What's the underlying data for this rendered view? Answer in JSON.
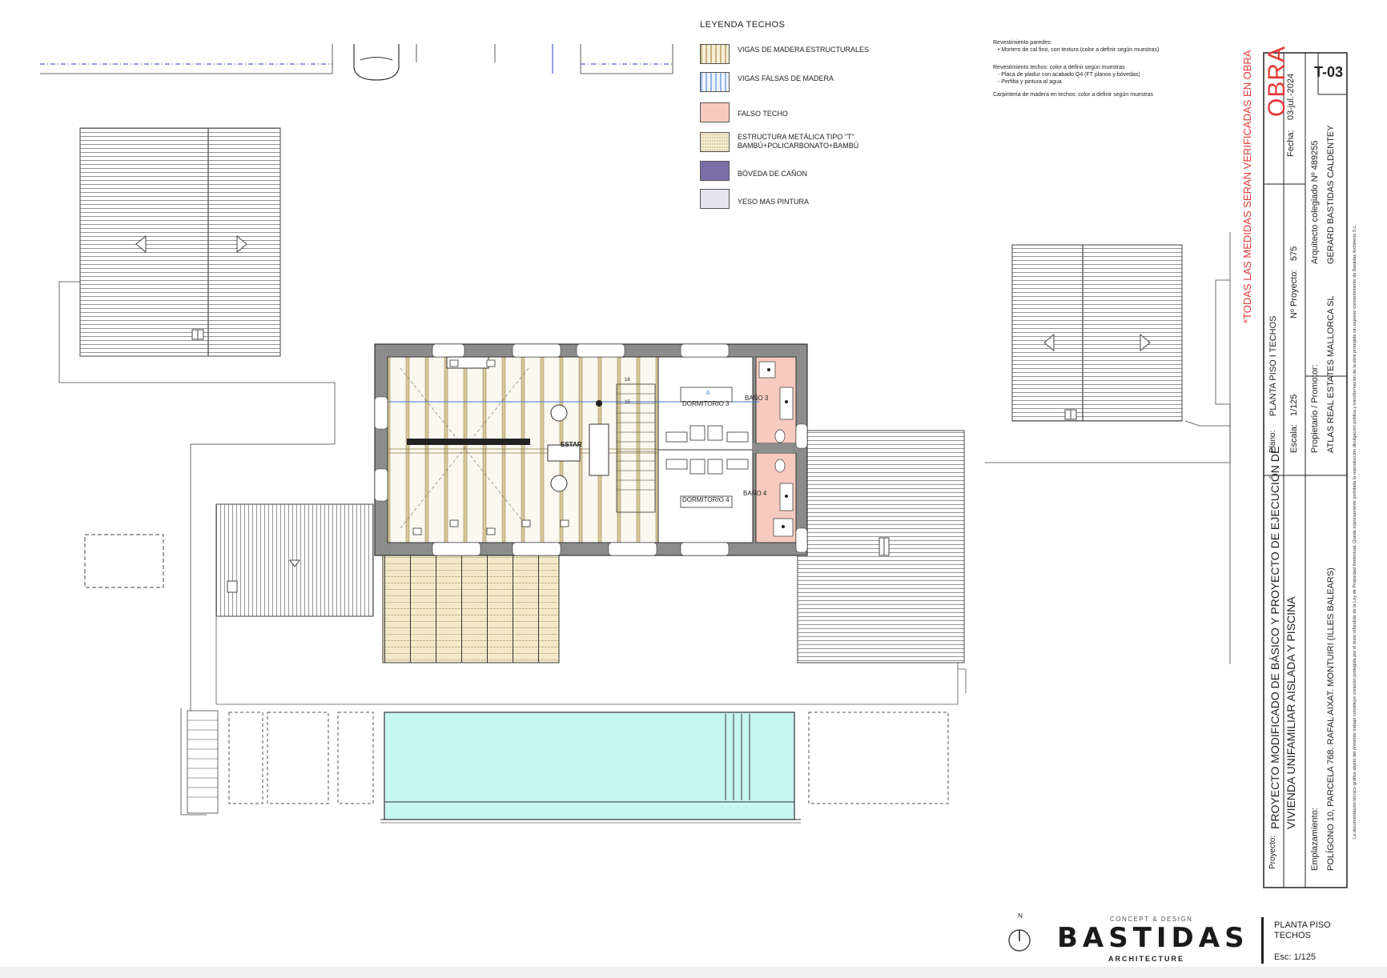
{
  "legend": {
    "title": "LEYENDA TECHOS",
    "items": [
      {
        "label": "VIGAS DE MADERA ESTRUCTURALES",
        "swatch": "wood-beams"
      },
      {
        "label": "VIGAS FALSAS DE MADERA",
        "swatch": "fake-beams"
      },
      {
        "label": "FALSO TECHO",
        "swatch": "false-ceiling"
      },
      {
        "label": "ESTRUCTURA METÁLICA TIPO \"T\"\nBAMBÚ+POLICARBONATO+BAMBÚ",
        "swatch": "metal-t"
      },
      {
        "label": "BÓVEDA DE CAÑON",
        "swatch": "barrel-vault"
      },
      {
        "label": "YESO MAS PINTURA",
        "swatch": "plaster"
      }
    ]
  },
  "notes": {
    "walls_title": "Revestimiento paredes:",
    "walls_item": "•      Mortero de cal fino, con textura (color a definir según muestras)",
    "ceilings_title": "Revestimiento techos: color a definir según muestras",
    "ceilings_item1": "- Placa de pladur con acabado Q4 (FT planos y bóvedas)",
    "ceilings_item2": "- Perfilta y pintura al agua",
    "carpentry": "Carpintería de madera en techos: color a definir según muestras"
  },
  "plan_labels": {
    "estar": "ESTAR",
    "dormitorio3": "DORMITORIO 3",
    "dormitorio4": "DORMITORIO 4",
    "bano3": "BAÑO 3",
    "bano4": "BAÑO 4",
    "stair_top": "18",
    "stair_mid": "15",
    "section_mark": "A"
  },
  "title_block": {
    "warning": "*TODAS LAS MEDIDAS SERAN VERIFICADAS EN OBRA",
    "sheet_code": "T-03",
    "obra": "OBRA",
    "fecha_label": "Fecha:",
    "fecha_value": "03-jul.-2024",
    "plano_label": "Plano:",
    "plano_value": "PLANTA PISO I TECHOS",
    "escala_label": "Escala:",
    "escala_value": "1/125",
    "nproyecto_label": "Nº Proyecto:",
    "nproyecto_value": "575",
    "propietario_label": "Propietario / Promotor:",
    "propietario_value": "ATLAS REAL ESTATES MALLORCA SL",
    "arquitecto_label": "Arquitecto colegiado Nº 489255",
    "arquitecto_value": "GERARD BASTIDAS CALDENTEY",
    "proyecto_label": "Proyecto:",
    "proyecto_line1": "PROYECTO  MODIFICADO DE BÁSICO Y PROYECTO DE EJECUCIÓN DE",
    "proyecto_line2": "VIVIENDA UNIFAMILIAR AISLADA Y PISCINA",
    "emplazamiento_label": "Emplazamiento:",
    "emplazamiento_value": "POLÍGONO 10, PARCELA 768. RAFAL AIXAT. MONTUIRI (ILLES BALEARS)",
    "copyright": "La documentación técnico-gráfica objeto del presente trabajo constituye creación protegida por el texto refundido de la Ley de Propiedad Intelectual. Queda expresamente prohibida la reproducción divulgación pública y transformación de la obra protegida sin expreso consentimiento de Bastidas Architects S.L."
  },
  "logo": {
    "north": "N",
    "tagline": "CONCEPT & DESIGN",
    "brand": "BASTIDAS",
    "sub": "ARCHITECTURE",
    "sheet_title_line1": "PLANTA PISO",
    "sheet_title_line2": "TECHOS",
    "scale": "Esc: 1/125"
  },
  "colors": {
    "wall": "#8c8c8c",
    "wood_beam": "#d8c89a",
    "fake_beam": "#3a7bd5",
    "false_ceiling": "#f6cbbd",
    "barrel_vault": "#7c6fa8",
    "plaster": "#e6e4ee",
    "pool": "#c8f6f2",
    "red": "#e53935"
  }
}
